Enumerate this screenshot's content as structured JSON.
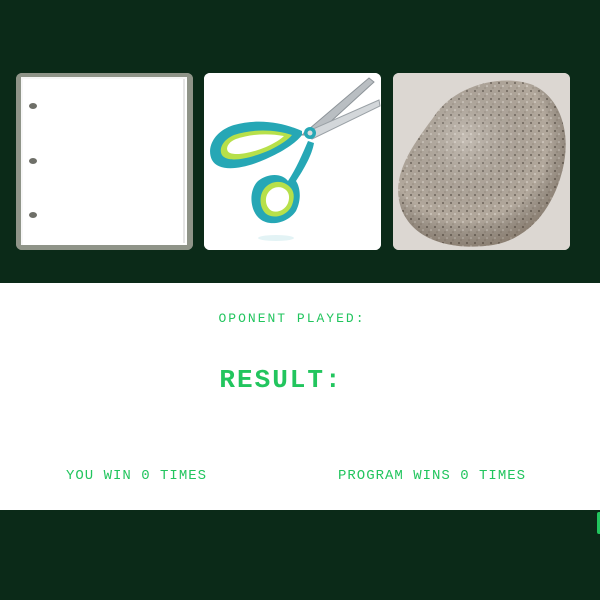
{
  "choices": [
    {
      "id": "paper",
      "label": "paper"
    },
    {
      "id": "scissors",
      "label": "scissors"
    },
    {
      "id": "rock",
      "label": "rock"
    }
  ],
  "opponent": {
    "label": "OPONENT PLAYED:"
  },
  "result": {
    "label": "RESULT:"
  },
  "scores": {
    "you": "YOU WIN 0 TIMES",
    "program": "PROGRAM WINS 0 TIMES"
  },
  "colors": {
    "background": "#0b2a18",
    "panel": "#ffffff",
    "accent": "#22c55e"
  }
}
